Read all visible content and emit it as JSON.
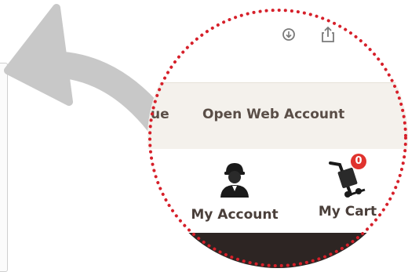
{
  "toolbar": {
    "icons": [
      "download-icon",
      "share-icon"
    ]
  },
  "nav": {
    "cut_item": "ue",
    "open_web_account": "Open Web Account"
  },
  "account": {
    "my_account_label": "My Account",
    "my_cart_label": "My Cart",
    "cart_count": "0"
  },
  "colors": {
    "zoom_border": "#d6202a",
    "arrow": "#c8c8c8",
    "nav_background": "#f4f1ec",
    "text": "#4a3f3a",
    "badge": "#e0332e",
    "dark_bar": "#2d2523"
  }
}
